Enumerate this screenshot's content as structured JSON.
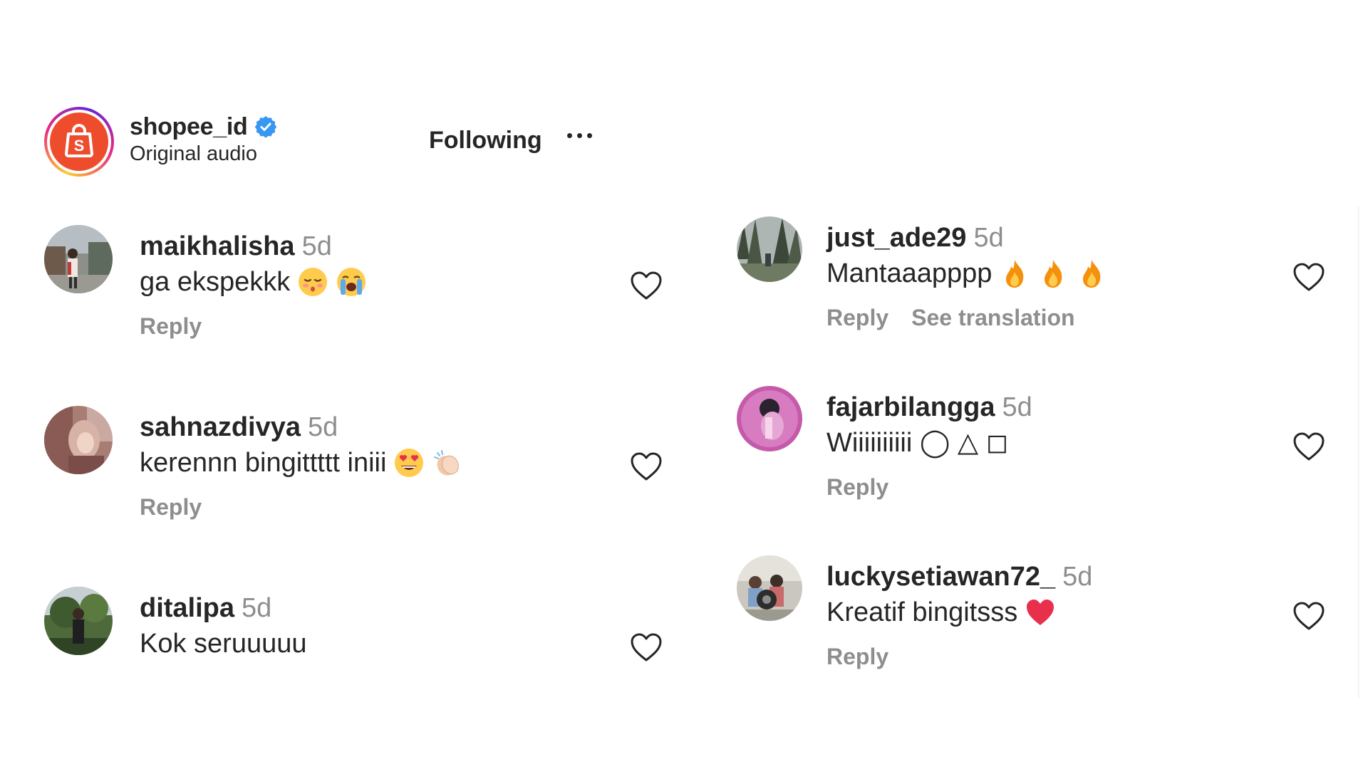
{
  "header": {
    "username": "shopee_id",
    "subtitle": "Original audio",
    "follow_label": "Following",
    "brand_color": "#ee4d2d",
    "verified_color": "#3897f0",
    "avatar_letter": "S"
  },
  "comments_left": [
    {
      "username": "maikhalisha",
      "time": "5d",
      "text": "ga ekspekkk",
      "emojis": [
        "relieved-pout-emoji",
        "loudly-crying-emoji"
      ],
      "actions": [
        "Reply"
      ]
    },
    {
      "username": "sahnazdivya",
      "time": "5d",
      "text": "kerennn bingittttt iniii",
      "emojis": [
        "heart-eyes-emoji",
        "clapping-hands-emoji"
      ],
      "actions": [
        "Reply"
      ]
    },
    {
      "username": "ditalipa",
      "time": "5d",
      "text": "Kok seruuuuu",
      "emojis": [],
      "actions": []
    }
  ],
  "comments_right": [
    {
      "username": "just_ade29",
      "time": "5d",
      "text": "Mantaaapppp",
      "emojis": [
        "fire-emoji",
        "fire-emoji",
        "fire-emoji"
      ],
      "actions": [
        "Reply",
        "See translation"
      ]
    },
    {
      "username": "fajarbilangga",
      "time": "5d",
      "text": "Wiiiiiiiiii ◯ △ ◻",
      "emojis": [],
      "actions": [
        "Reply"
      ]
    },
    {
      "username": "luckysetiawan72_",
      "time": "5d",
      "text": "Kreatif bingitsss",
      "emojis": [
        "red-heart-emoji"
      ],
      "actions": [
        "Reply"
      ]
    }
  ]
}
